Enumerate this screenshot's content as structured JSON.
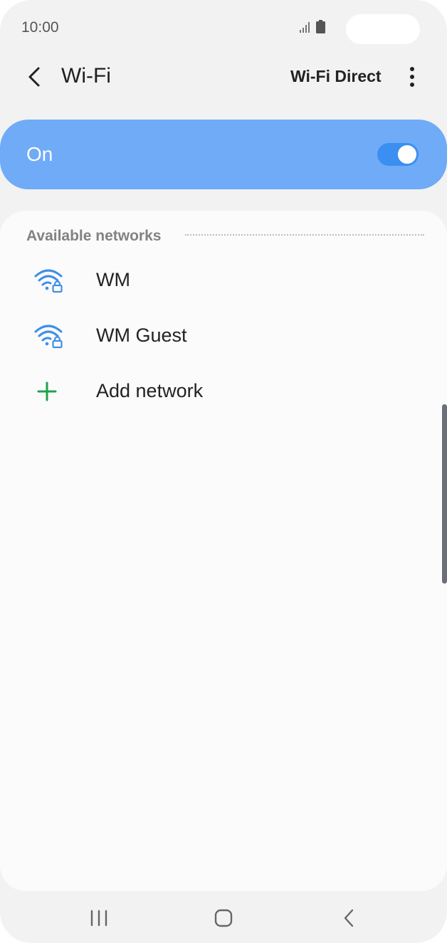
{
  "status_bar": {
    "time": "10:00"
  },
  "header": {
    "title": "Wi-Fi",
    "wifi_direct_label": "Wi-Fi Direct"
  },
  "toggle": {
    "label": "On",
    "state": "on"
  },
  "networks": {
    "section_title": "Available networks",
    "items": [
      {
        "label": "WM",
        "icon": "wifi-locked-icon"
      },
      {
        "label": "WM Guest",
        "icon": "wifi-locked-icon"
      },
      {
        "label": "Add network",
        "icon": "plus-icon"
      }
    ]
  },
  "colors": {
    "accent": "#3b8ff0",
    "toggle_card": "#6fabf7",
    "wifi_icon": "#3f8fe8",
    "add_icon": "#1fa24a"
  }
}
